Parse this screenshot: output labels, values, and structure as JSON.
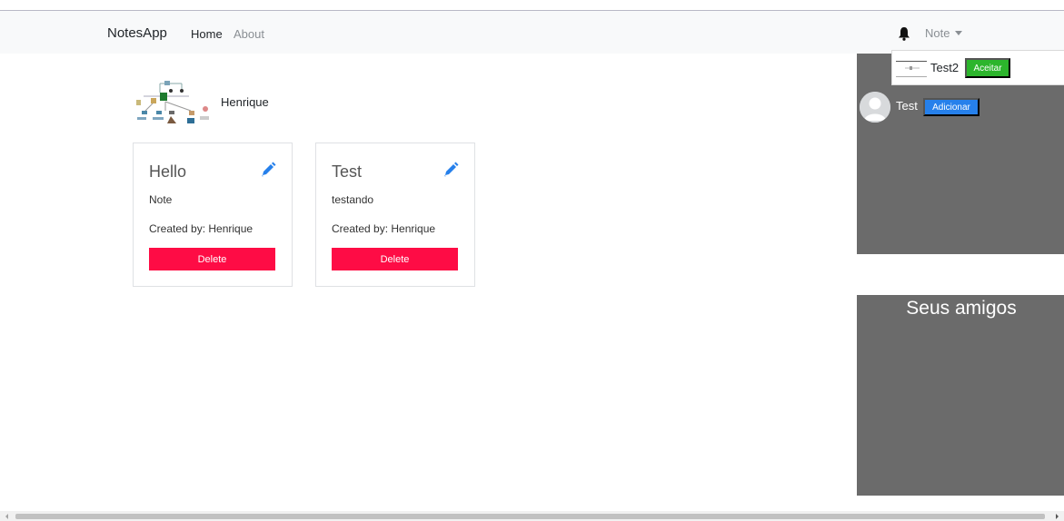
{
  "navbar": {
    "brand": "NotesApp",
    "links": [
      {
        "label": "Home",
        "active": true
      },
      {
        "label": "About",
        "active": false
      }
    ],
    "bell_icon": "bell-icon",
    "dropdown_label": "Note"
  },
  "profile": {
    "name": "Henrique"
  },
  "notes": [
    {
      "title": "Hello",
      "text": "Note",
      "created_by": "Created by: Henrique",
      "delete_label": "Delete",
      "edit_icon": "pencil-icon"
    },
    {
      "title": "Test",
      "text": "testando",
      "created_by": "Created by: Henrique",
      "delete_label": "Delete",
      "edit_icon": "pencil-icon"
    }
  ],
  "notifications": {
    "items": [
      {
        "name": "Test2",
        "action_label": "Aceitar"
      }
    ]
  },
  "suggestions": {
    "items": [
      {
        "name": "Test",
        "action_label": "Adicionar"
      }
    ]
  },
  "friends": {
    "title": "Seus amigos"
  },
  "colors": {
    "navbar_bg": "#f8f9fa",
    "delete": "#fe0c45",
    "add": "#2680eb",
    "accept": "#2cb52c",
    "panel": "#6b6b6b",
    "pencil": "#2680eb"
  }
}
